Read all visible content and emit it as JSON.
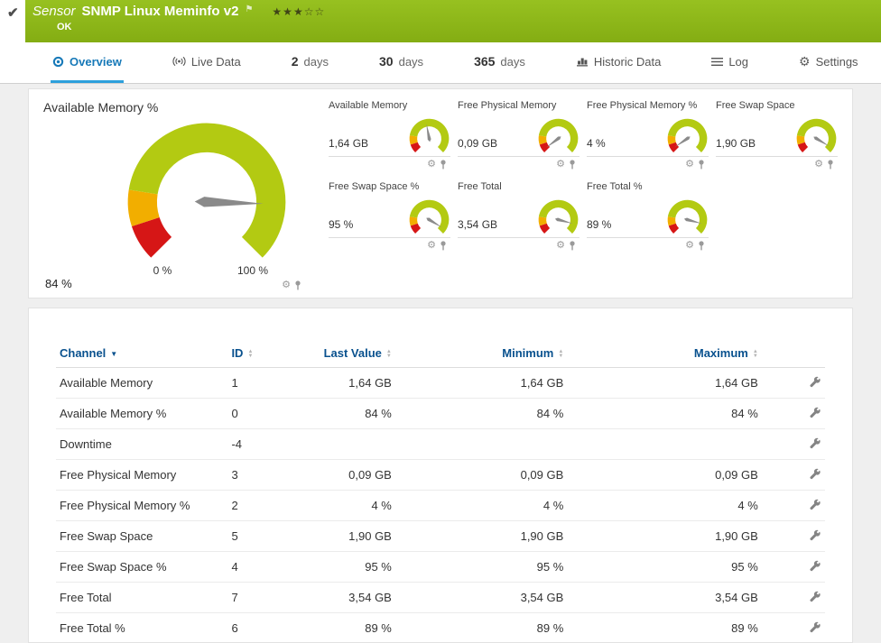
{
  "header": {
    "kind": "Sensor",
    "title": "SNMP Linux Meminfo v2",
    "status": "OK",
    "rating_filled": 3,
    "rating_total": 5
  },
  "tabs": {
    "overview": "Overview",
    "live_data": "Live Data",
    "days_2": {
      "num": "2",
      "unit": "days"
    },
    "days_30": {
      "num": "30",
      "unit": "days"
    },
    "days_365": {
      "num": "365",
      "unit": "days"
    },
    "historic": "Historic Data",
    "log": "Log",
    "settings": "Settings"
  },
  "main_gauge": {
    "title": "Available Memory %",
    "value": "84 %",
    "percent": 84,
    "min_label": "0 %",
    "max_label": "100 %"
  },
  "small_gauges": [
    {
      "title": "Available Memory",
      "value": "1,64 GB",
      "percent": 46
    },
    {
      "title": "Free Physical Memory",
      "value": "0,09 GB",
      "percent": 3
    },
    {
      "title": "Free Physical Memory %",
      "value": "4 %",
      "percent": 4
    },
    {
      "title": "Free Swap Space",
      "value": "1,90 GB",
      "percent": 95
    },
    {
      "title": "Free Swap Space %",
      "value": "95 %",
      "percent": 95
    },
    {
      "title": "Free Total",
      "value": "3,54 GB",
      "percent": 89
    },
    {
      "title": "Free Total %",
      "value": "89 %",
      "percent": 89
    }
  ],
  "table": {
    "headers": {
      "channel": "Channel",
      "id": "ID",
      "last": "Last Value",
      "min": "Minimum",
      "max": "Maximum"
    },
    "rows": [
      {
        "channel": "Available Memory",
        "id": "1",
        "last": "1,64 GB",
        "min": "1,64 GB",
        "max": "1,64 GB"
      },
      {
        "channel": "Available Memory %",
        "id": "0",
        "last": "84 %",
        "min": "84 %",
        "max": "84 %"
      },
      {
        "channel": "Downtime",
        "id": "-4",
        "last": "",
        "min": "",
        "max": ""
      },
      {
        "channel": "Free Physical Memory",
        "id": "3",
        "last": "0,09 GB",
        "min": "0,09 GB",
        "max": "0,09 GB"
      },
      {
        "channel": "Free Physical Memory %",
        "id": "2",
        "last": "4 %",
        "min": "4 %",
        "max": "4 %"
      },
      {
        "channel": "Free Swap Space",
        "id": "5",
        "last": "1,90 GB",
        "min": "1,90 GB",
        "max": "1,90 GB"
      },
      {
        "channel": "Free Swap Space %",
        "id": "4",
        "last": "95 %",
        "min": "95 %",
        "max": "95 %"
      },
      {
        "channel": "Free Total",
        "id": "7",
        "last": "3,54 GB",
        "min": "3,54 GB",
        "max": "3,54 GB"
      },
      {
        "channel": "Free Total %",
        "id": "6",
        "last": "89 %",
        "min": "89 %",
        "max": "89 %"
      }
    ]
  },
  "icons": {
    "check": "✔",
    "flag": "⚑",
    "star_filled": "★",
    "star_empty": "☆",
    "gear": "⚙",
    "sort_asc": "▲",
    "sort_desc": "▼",
    "caret_down": "▼"
  },
  "colors": {
    "header_green": "#84ad13",
    "header_green_light": "#97c120",
    "tab_active": "#1779b8",
    "tab_underline": "#2da0dc",
    "table_header_blue": "#09518e",
    "gauge_green": "#b3ca12",
    "gauge_yellow": "#f2ae00",
    "gauge_red": "#d61616",
    "panel_border": "#e2e2e2",
    "page_background": "#efefef"
  }
}
